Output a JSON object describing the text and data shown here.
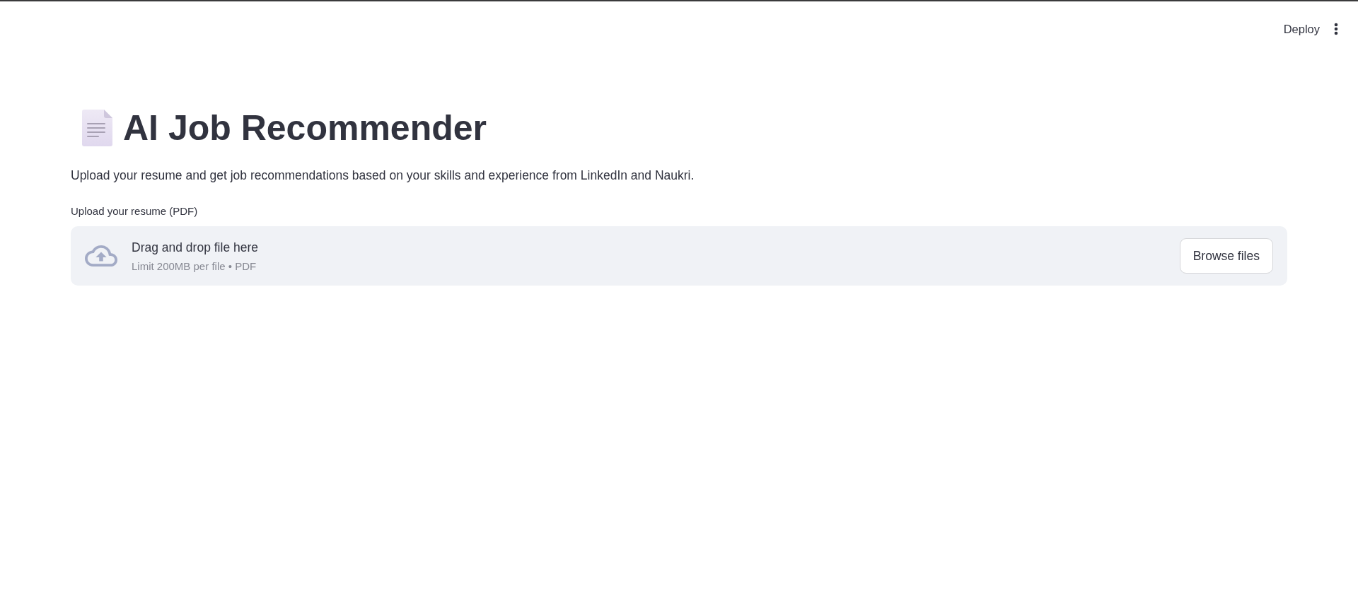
{
  "header": {
    "deploy_label": "Deploy"
  },
  "title": "AI Job Recommender",
  "description": "Upload your resume and get job recommendations based on your skills and experience from LinkedIn and Naukri.",
  "uploader": {
    "label": "Upload your resume (PDF)",
    "instruction": "Drag and drop file here",
    "limit": "Limit 200MB per file • PDF",
    "button": "Browse files"
  }
}
